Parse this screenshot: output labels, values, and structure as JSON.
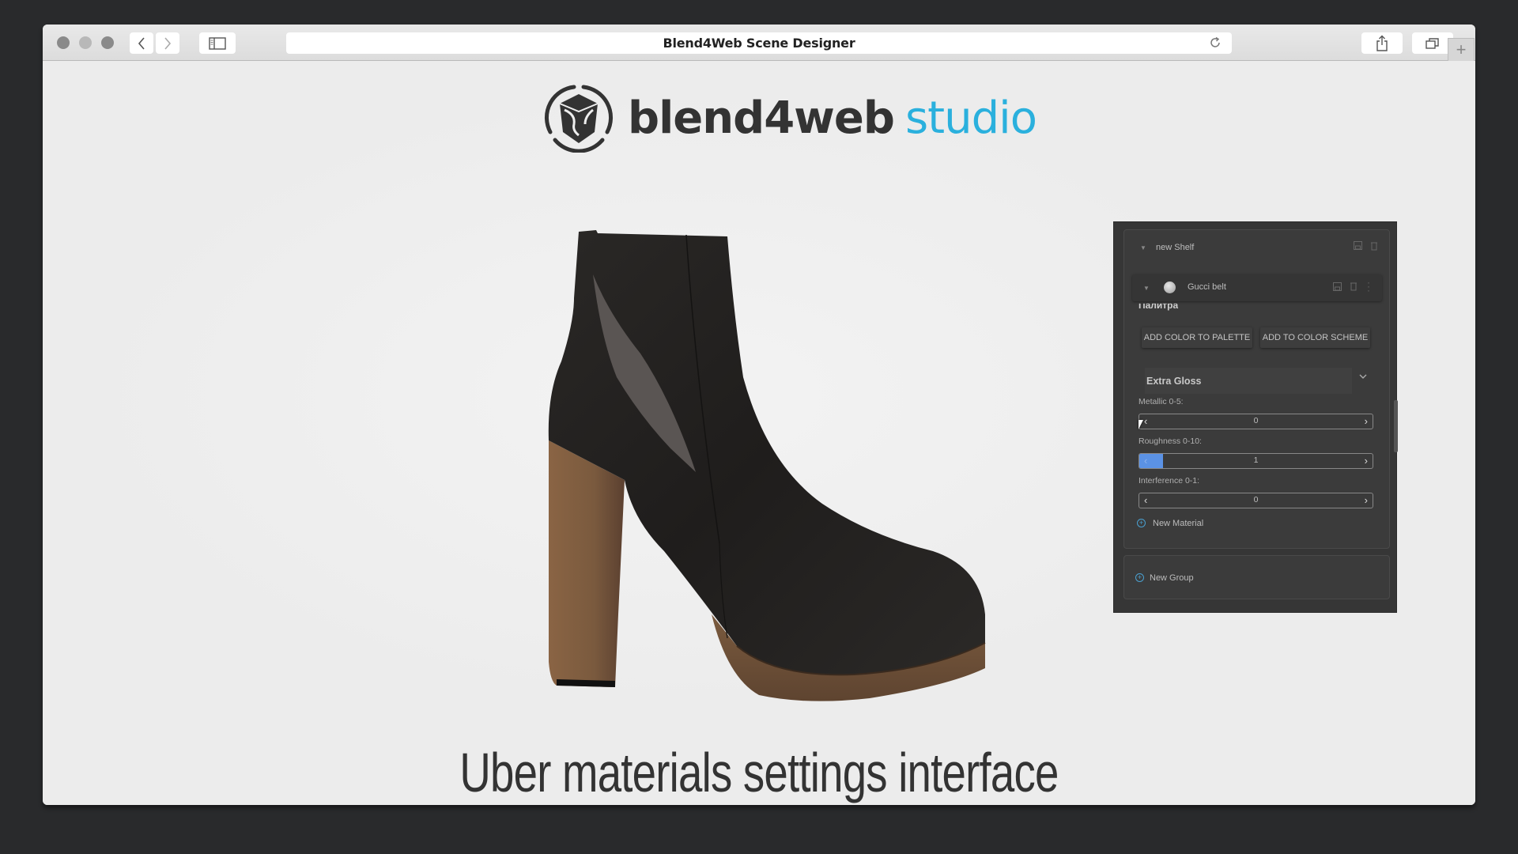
{
  "browser": {
    "title": "Blend4Web Scene Designer",
    "icons": {
      "back": "chevron-left-icon",
      "forward": "chevron-right-icon",
      "sidebar": "sidebar-icon",
      "reload": "reload-icon",
      "share": "share-icon",
      "tabs": "tabs-icon",
      "new_tab": "plus-icon"
    }
  },
  "logo": {
    "brand": "blend4web",
    "product": "studio",
    "brand_color": "#333333",
    "product_color": "#2ab0dd"
  },
  "viewer": {
    "object": "ankle boot with block heel and platform sole"
  },
  "caption": "Uber materials settings interface",
  "panel": {
    "shelf": {
      "name": "new Shelf"
    },
    "material": {
      "name": "Gucci belt"
    },
    "palette_label": "Палитра",
    "buttons": {
      "add_to_palette": "ADD COLOR TO PALETTE",
      "add_to_scheme": "ADD TO COLOR SCHEME"
    },
    "preset": {
      "selected": "Extra Gloss"
    },
    "sliders": [
      {
        "label": "Metallic 0-5:",
        "value": "0",
        "min": 0,
        "max": 5,
        "fill_fraction": 0
      },
      {
        "label": "Roughness 0-10:",
        "value": "1",
        "min": 0,
        "max": 10,
        "fill_fraction": 0.1
      },
      {
        "label": "Interference 0-1:",
        "value": "0",
        "min": 0,
        "max": 1,
        "fill_fraction": 0
      }
    ],
    "new_material": "New Material",
    "new_group": "New Group",
    "accent_color": "#5b92e5"
  }
}
